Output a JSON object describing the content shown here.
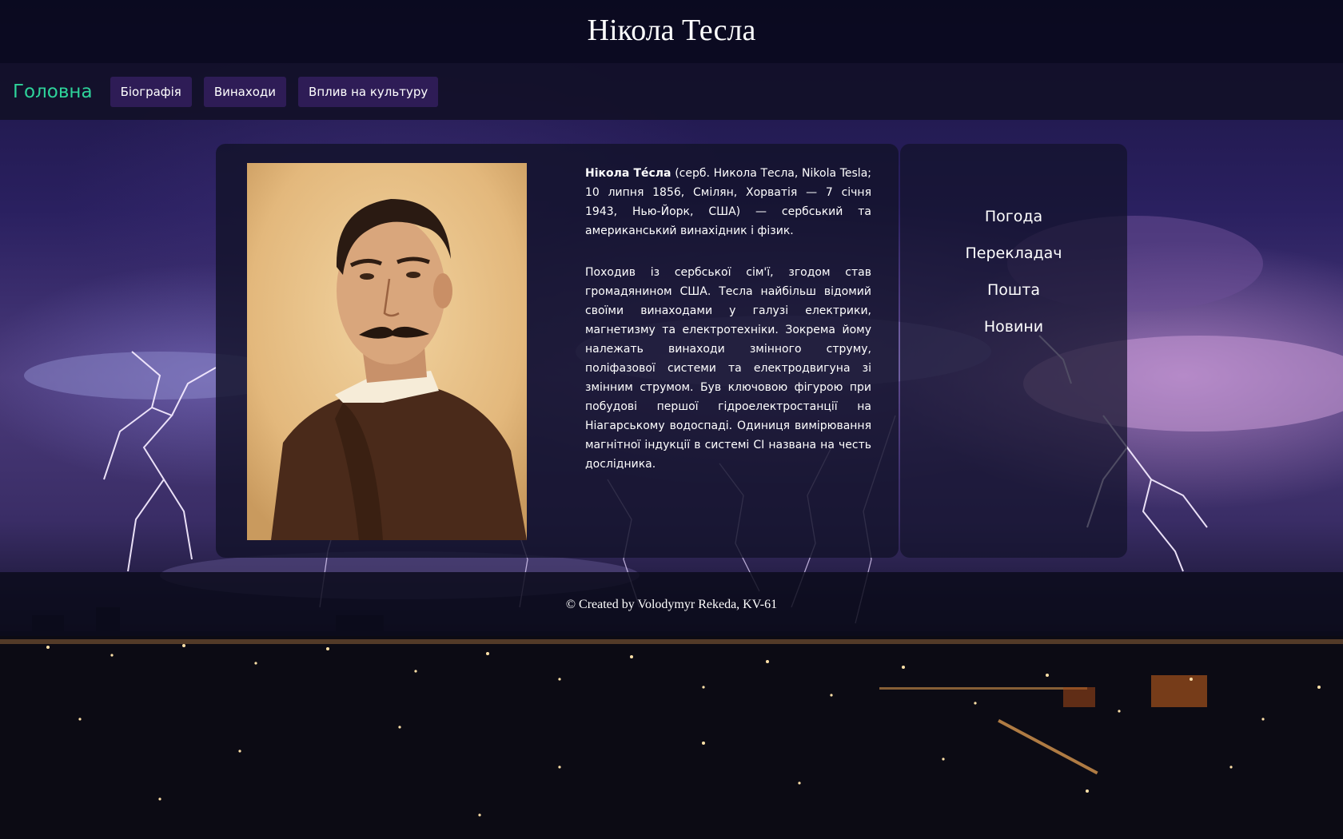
{
  "header": {
    "title": "Нікола Тесла"
  },
  "nav": {
    "home": "Головна",
    "items": [
      "Біографія",
      "Винаходи",
      "Вплив на культуру"
    ]
  },
  "article": {
    "name_bold": "Нікола Те́сла",
    "intro_rest": " (серб. Никола Тесла, Nikola Tesla; 10 липня 1856, Смілян, Хорватія — 7 січня 1943, Нью-Йорк, США) — сербський та американський винахідник і фізик.",
    "paragraph2": "Походив із сербської сім'ї, згодом став громадянином США. Тесла найбільш відомий своїми винаходами у галузі електрики, магнетизму та електротехніки. Зокрема йому належать винаходи змінного струму, поліфазової системи та електродвигуна зі змінним струмом. Був ключовою фігурою при побудові першої гідроелектростанції на Ніагарському водоспаді. Одиниця вимірювання магнітної індукції в системі СІ названа на честь дослідника."
  },
  "sidebar": {
    "links": [
      "Погода",
      "Перекладач",
      "Пошта",
      "Новини"
    ]
  },
  "footer": {
    "text": "© Created by Volodymyr Rekeda, KV-61"
  },
  "colors": {
    "home_link": "#2ed39a",
    "nav_button": "#2e1c56",
    "header_bg": "#0a0a1e"
  }
}
